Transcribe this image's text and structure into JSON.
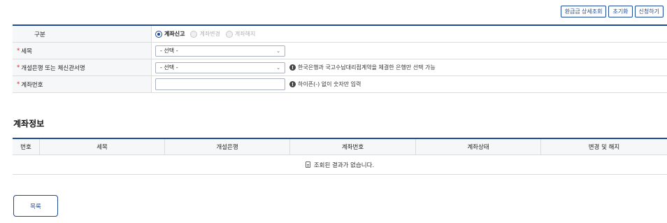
{
  "toolbar": {
    "refund_detail": "환급금 상세조회",
    "reset": "초기화",
    "apply": "신청하기"
  },
  "form": {
    "type_label": "구분",
    "radios": [
      {
        "label": "계좌신고",
        "selected": true
      },
      {
        "label": "계좌변경",
        "selected": false
      },
      {
        "label": "계좌해지",
        "selected": false
      }
    ],
    "tax_label": "세목",
    "tax_select": "- 선택 -",
    "bank_label": "개설은행 또는 체신관서명",
    "bank_select": "- 선택 -",
    "bank_hint": "한국은행과 국고수납대리점계약을 체결한 은행만 선택 가능",
    "account_label": "계좌번호",
    "account_value": "",
    "account_hint": "하이픈(-) 없이 숫자만 입력",
    "required_mark": "*"
  },
  "account_info": {
    "title": "계좌정보",
    "columns": [
      "번호",
      "세목",
      "개설은행",
      "계좌번호",
      "계좌상태",
      "변경 및 해지"
    ],
    "empty_message": "조회된 결과가 없습니다."
  },
  "footer": {
    "list_button": "목록"
  },
  "colors": {
    "accent": "#1e4a99",
    "required": "#d62828"
  }
}
